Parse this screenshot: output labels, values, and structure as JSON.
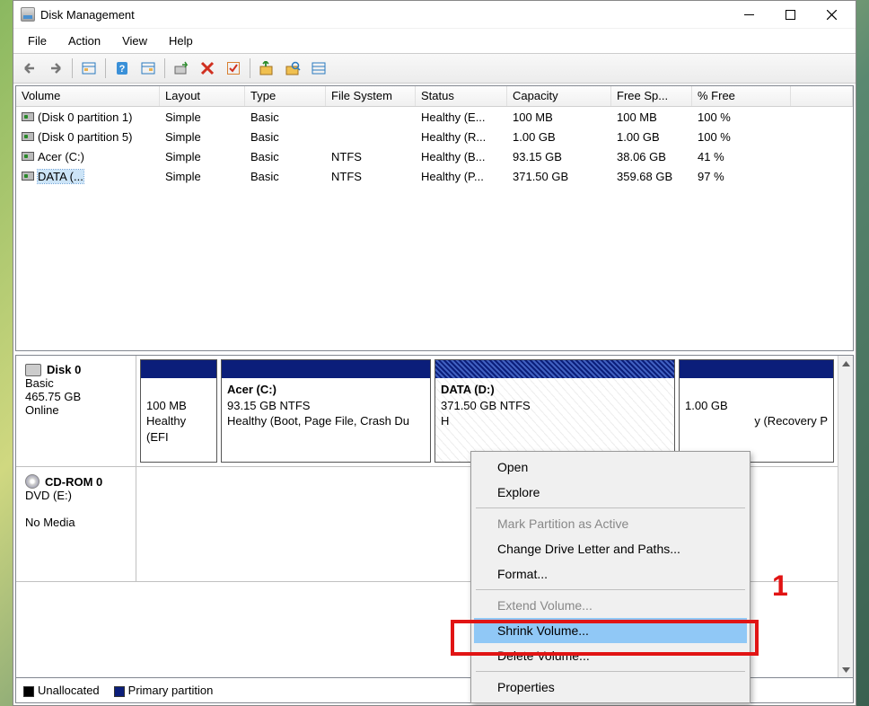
{
  "window": {
    "title": "Disk Management"
  },
  "menu": {
    "file": "File",
    "action": "Action",
    "view": "View",
    "help": "Help"
  },
  "columns": {
    "volume": "Volume",
    "layout": "Layout",
    "type": "Type",
    "fs": "File System",
    "status": "Status",
    "capacity": "Capacity",
    "free": "Free Sp...",
    "pct": "% Free"
  },
  "volumes": [
    {
      "name": "(Disk 0 partition 1)",
      "layout": "Simple",
      "type": "Basic",
      "fs": "",
      "status": "Healthy (E...",
      "capacity": "100 MB",
      "free": "100 MB",
      "pct": "100 %"
    },
    {
      "name": "(Disk 0 partition 5)",
      "layout": "Simple",
      "type": "Basic",
      "fs": "",
      "status": "Healthy (R...",
      "capacity": "1.00 GB",
      "free": "1.00 GB",
      "pct": "100 %"
    },
    {
      "name": "Acer (C:)",
      "layout": "Simple",
      "type": "Basic",
      "fs": "NTFS",
      "status": "Healthy (B...",
      "capacity": "93.15 GB",
      "free": "38.06 GB",
      "pct": "41 %"
    },
    {
      "name": "DATA (...",
      "layout": "Simple",
      "type": "Basic",
      "fs": "NTFS",
      "status": "Healthy (P...",
      "capacity": "371.50 GB",
      "free": "359.68 GB",
      "pct": "97 %"
    }
  ],
  "disks": {
    "disk0": {
      "name": "Disk 0",
      "type": "Basic",
      "size": "465.75 GB",
      "status": "Online"
    },
    "cdrom": {
      "name": "CD-ROM 0",
      "type": "DVD (E:)",
      "status": "No Media"
    }
  },
  "parts": {
    "p1": {
      "size": "100 MB",
      "status": "Healthy (EFI"
    },
    "p2": {
      "title": "Acer  (C:)",
      "sub": "93.15 GB NTFS",
      "status": "Healthy (Boot, Page File, Crash Du"
    },
    "p3": {
      "title": "DATA  (D:)",
      "sub": "371.50 GB NTFS",
      "status": "H"
    },
    "p4": {
      "size": "1.00 GB",
      "status": "y (Recovery P"
    }
  },
  "legend": {
    "unallocated": "Unallocated",
    "primary": "Primary partition"
  },
  "ctx": {
    "open": "Open",
    "explore": "Explore",
    "mark": "Mark Partition as Active",
    "change": "Change Drive Letter and Paths...",
    "format": "Format...",
    "extend": "Extend Volume...",
    "shrink": "Shrink Volume...",
    "delete": "Delete Volume...",
    "props": "Properties"
  },
  "annot": {
    "one": "1"
  }
}
